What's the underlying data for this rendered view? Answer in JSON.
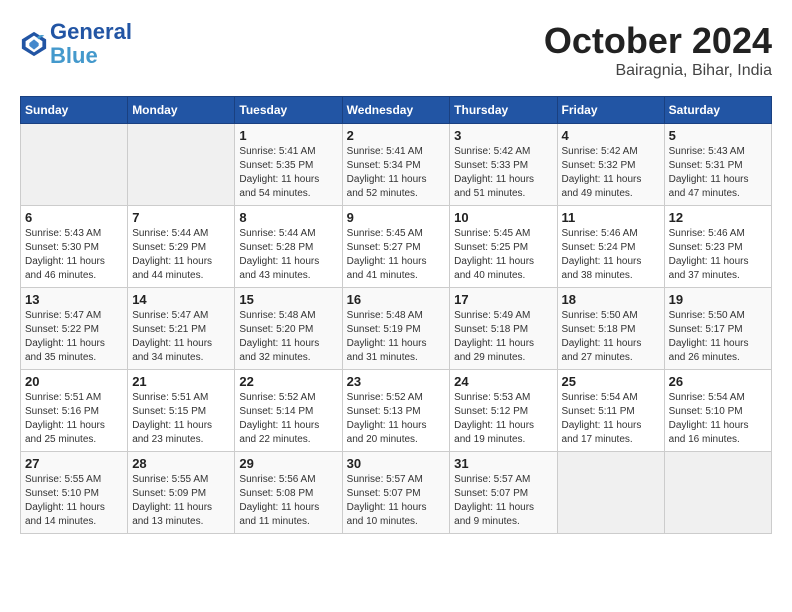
{
  "header": {
    "logo_line1": "General",
    "logo_line2": "Blue",
    "month": "October 2024",
    "location": "Bairagnia, Bihar, India"
  },
  "weekdays": [
    "Sunday",
    "Monday",
    "Tuesday",
    "Wednesday",
    "Thursday",
    "Friday",
    "Saturday"
  ],
  "weeks": [
    [
      {
        "day": "",
        "empty": true
      },
      {
        "day": "",
        "empty": true
      },
      {
        "day": "1",
        "sunrise": "5:41 AM",
        "sunset": "5:35 PM",
        "daylight": "11 hours and 54 minutes."
      },
      {
        "day": "2",
        "sunrise": "5:41 AM",
        "sunset": "5:34 PM",
        "daylight": "11 hours and 52 minutes."
      },
      {
        "day": "3",
        "sunrise": "5:42 AM",
        "sunset": "5:33 PM",
        "daylight": "11 hours and 51 minutes."
      },
      {
        "day": "4",
        "sunrise": "5:42 AM",
        "sunset": "5:32 PM",
        "daylight": "11 hours and 49 minutes."
      },
      {
        "day": "5",
        "sunrise": "5:43 AM",
        "sunset": "5:31 PM",
        "daylight": "11 hours and 47 minutes."
      }
    ],
    [
      {
        "day": "6",
        "sunrise": "5:43 AM",
        "sunset": "5:30 PM",
        "daylight": "11 hours and 46 minutes."
      },
      {
        "day": "7",
        "sunrise": "5:44 AM",
        "sunset": "5:29 PM",
        "daylight": "11 hours and 44 minutes."
      },
      {
        "day": "8",
        "sunrise": "5:44 AM",
        "sunset": "5:28 PM",
        "daylight": "11 hours and 43 minutes."
      },
      {
        "day": "9",
        "sunrise": "5:45 AM",
        "sunset": "5:27 PM",
        "daylight": "11 hours and 41 minutes."
      },
      {
        "day": "10",
        "sunrise": "5:45 AM",
        "sunset": "5:25 PM",
        "daylight": "11 hours and 40 minutes."
      },
      {
        "day": "11",
        "sunrise": "5:46 AM",
        "sunset": "5:24 PM",
        "daylight": "11 hours and 38 minutes."
      },
      {
        "day": "12",
        "sunrise": "5:46 AM",
        "sunset": "5:23 PM",
        "daylight": "11 hours and 37 minutes."
      }
    ],
    [
      {
        "day": "13",
        "sunrise": "5:47 AM",
        "sunset": "5:22 PM",
        "daylight": "11 hours and 35 minutes."
      },
      {
        "day": "14",
        "sunrise": "5:47 AM",
        "sunset": "5:21 PM",
        "daylight": "11 hours and 34 minutes."
      },
      {
        "day": "15",
        "sunrise": "5:48 AM",
        "sunset": "5:20 PM",
        "daylight": "11 hours and 32 minutes."
      },
      {
        "day": "16",
        "sunrise": "5:48 AM",
        "sunset": "5:19 PM",
        "daylight": "11 hours and 31 minutes."
      },
      {
        "day": "17",
        "sunrise": "5:49 AM",
        "sunset": "5:18 PM",
        "daylight": "11 hours and 29 minutes."
      },
      {
        "day": "18",
        "sunrise": "5:50 AM",
        "sunset": "5:18 PM",
        "daylight": "11 hours and 27 minutes."
      },
      {
        "day": "19",
        "sunrise": "5:50 AM",
        "sunset": "5:17 PM",
        "daylight": "11 hours and 26 minutes."
      }
    ],
    [
      {
        "day": "20",
        "sunrise": "5:51 AM",
        "sunset": "5:16 PM",
        "daylight": "11 hours and 25 minutes."
      },
      {
        "day": "21",
        "sunrise": "5:51 AM",
        "sunset": "5:15 PM",
        "daylight": "11 hours and 23 minutes."
      },
      {
        "day": "22",
        "sunrise": "5:52 AM",
        "sunset": "5:14 PM",
        "daylight": "11 hours and 22 minutes."
      },
      {
        "day": "23",
        "sunrise": "5:52 AM",
        "sunset": "5:13 PM",
        "daylight": "11 hours and 20 minutes."
      },
      {
        "day": "24",
        "sunrise": "5:53 AM",
        "sunset": "5:12 PM",
        "daylight": "11 hours and 19 minutes."
      },
      {
        "day": "25",
        "sunrise": "5:54 AM",
        "sunset": "5:11 PM",
        "daylight": "11 hours and 17 minutes."
      },
      {
        "day": "26",
        "sunrise": "5:54 AM",
        "sunset": "5:10 PM",
        "daylight": "11 hours and 16 minutes."
      }
    ],
    [
      {
        "day": "27",
        "sunrise": "5:55 AM",
        "sunset": "5:10 PM",
        "daylight": "11 hours and 14 minutes."
      },
      {
        "day": "28",
        "sunrise": "5:55 AM",
        "sunset": "5:09 PM",
        "daylight": "11 hours and 13 minutes."
      },
      {
        "day": "29",
        "sunrise": "5:56 AM",
        "sunset": "5:08 PM",
        "daylight": "11 hours and 11 minutes."
      },
      {
        "day": "30",
        "sunrise": "5:57 AM",
        "sunset": "5:07 PM",
        "daylight": "11 hours and 10 minutes."
      },
      {
        "day": "31",
        "sunrise": "5:57 AM",
        "sunset": "5:07 PM",
        "daylight": "11 hours and 9 minutes."
      },
      {
        "day": "",
        "empty": true
      },
      {
        "day": "",
        "empty": true
      }
    ]
  ],
  "labels": {
    "sunrise_prefix": "Sunrise: ",
    "sunset_prefix": "Sunset: ",
    "daylight_prefix": "Daylight: "
  }
}
